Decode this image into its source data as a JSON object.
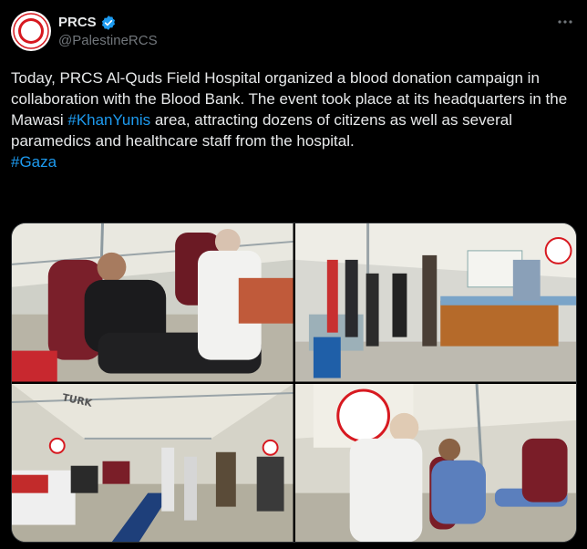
{
  "account": {
    "display_name": "PRCS",
    "handle": "@PalestineRCS",
    "avatar_icon": "red-crescent-icon",
    "verified_icon": "verified-badge-icon"
  },
  "post": {
    "text_1": "Today, PRCS Al-Quds Field Hospital organized a blood donation campaign in collaboration with the Blood Bank. The event took place at its headquarters in the Mawasi ",
    "hashtag_1": "#KhanYunis",
    "text_2": " area, attracting dozens of citizens as well as several paramedics and healthcare staff from the hospital.",
    "hashtag_2": "#Gaza"
  },
  "media": {
    "photo_signage": "TURK"
  },
  "colors": {
    "background": "#000000",
    "link": "#1d9bf0",
    "verified": "#1d9bf0",
    "brand_red": "#d71920"
  }
}
